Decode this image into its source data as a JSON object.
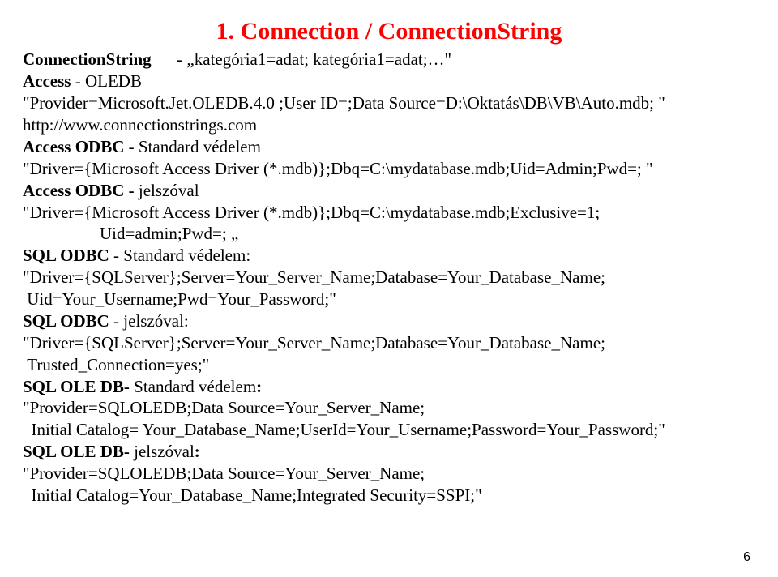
{
  "title": "1. Connection / ConnectionString",
  "l1a": "ConnectionString",
  "l1b": "      - „kategória1=adat; kategória1=adat;…\"",
  "l2a": "Access",
  "l2b": " - OLEDB",
  "l3": "\"Provider=Microsoft.Jet.OLEDB.4.0 ;User ID=;Data Source=D:\\Oktatás\\DB\\VB\\Auto.mdb; \"",
  "l4": "http://www.connectionstrings.com",
  "l5a": "Access ODBC",
  "l5b": " - Standard védelem",
  "l6": "\"Driver={Microsoft Access Driver (*.mdb)};Dbq=C:\\mydatabase.mdb;Uid=Admin;Pwd=; \"",
  "l7a": "Access ODBC - ",
  "l7b": "jelszóval",
  "l8": "\"Driver={Microsoft Access Driver (*.mdb)};Dbq=C:\\mydatabase.mdb;Exclusive=1;",
  "l9": "Uid=admin;Pwd=; „",
  "l10a": "SQL ODBC",
  "l10b": " - Standard védelem:",
  "l11": "\"Driver={SQLServer};Server=Your_Server_Name;Database=Your_Database_Name;",
  "l12": " Uid=Your_Username;Pwd=Your_Password;\"",
  "l13a": "SQL ODBC",
  "l13b": " - jelszóval:",
  "l14": "\"Driver={SQLServer};Server=Your_Server_Name;Database=Your_Database_Name;",
  "l15": " Trusted_Connection=yes;\"",
  "l16a": "SQL OLE DB",
  "l16b": "- ",
  "l16c": "Standard védelem",
  "l16d": ":",
  "l17": "\"Provider=SQLOLEDB;Data Source=Your_Server_Name;",
  "l18": "  Initial Catalog= Your_Database_Name;UserId=Your_Username;Password=Your_Password;\"",
  "l19a": "SQL OLE DB",
  "l19b": "- ",
  "l19c": "jelszóval",
  "l19d": ":",
  "l20": "\"Provider=SQLOLEDB;Data Source=Your_Server_Name;",
  "l21": "  Initial Catalog=Your_Database_Name;Integrated Security=SSPI;\"",
  "pageNum": "6"
}
